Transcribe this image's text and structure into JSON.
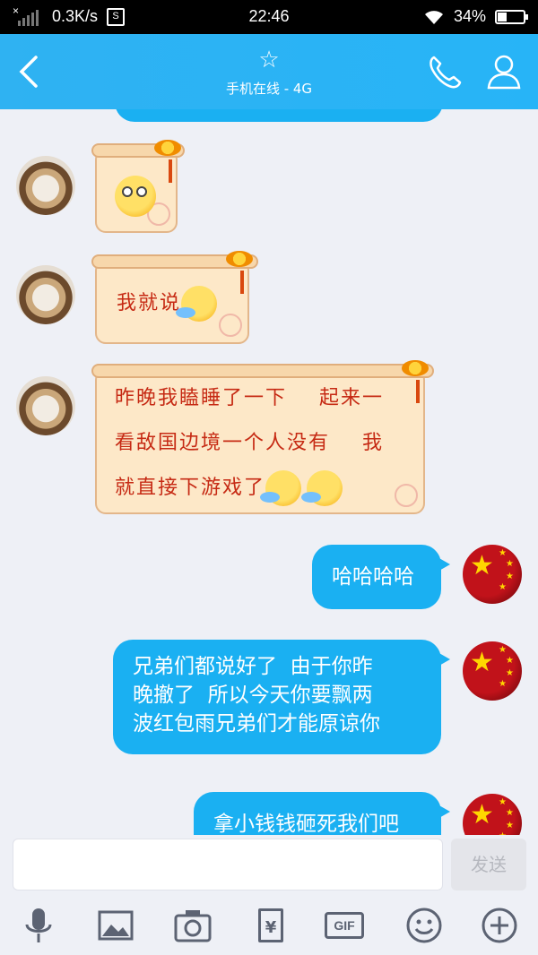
{
  "status_bar": {
    "net_speed": "0.3K/s",
    "time": "22:46",
    "battery_level": 34,
    "battery": "34%"
  },
  "header": {
    "title_icon": "star-icon",
    "subtitle": "手机在线 - 4G"
  },
  "messages": [
    {
      "side": "left",
      "type": "sticker-emoji"
    },
    {
      "side": "left",
      "text": "我就说"
    },
    {
      "side": "left",
      "text_lines": [
        "昨晚我瞌睡了一下    起来一",
        "看敌国边境一个人没有    我",
        "就直接下游戏了"
      ]
    },
    {
      "side": "right",
      "text": "哈哈哈哈"
    },
    {
      "side": "right",
      "text_lines": [
        "兄弟们都说好了  由于你昨",
        "晚撤了  所以今天你要飘两",
        "波红包雨兄弟们才能原谅你"
      ]
    },
    {
      "side": "right",
      "text": "拿小钱钱砸死我们吧"
    }
  ],
  "input": {
    "value": "",
    "send_label": "发送"
  },
  "toolbar": {
    "icons": [
      "microphone-icon",
      "image-icon",
      "camera-icon",
      "red-packet-icon",
      "gif-icon",
      "emoji-icon",
      "plus-icon"
    ],
    "gif_label": "GIF",
    "redpacket_label": "¥"
  },
  "colors": {
    "header": "#2fb2f2",
    "bubble": "#1ab0f2",
    "paper": "#fde8c8",
    "paper_text": "#c62a14"
  }
}
